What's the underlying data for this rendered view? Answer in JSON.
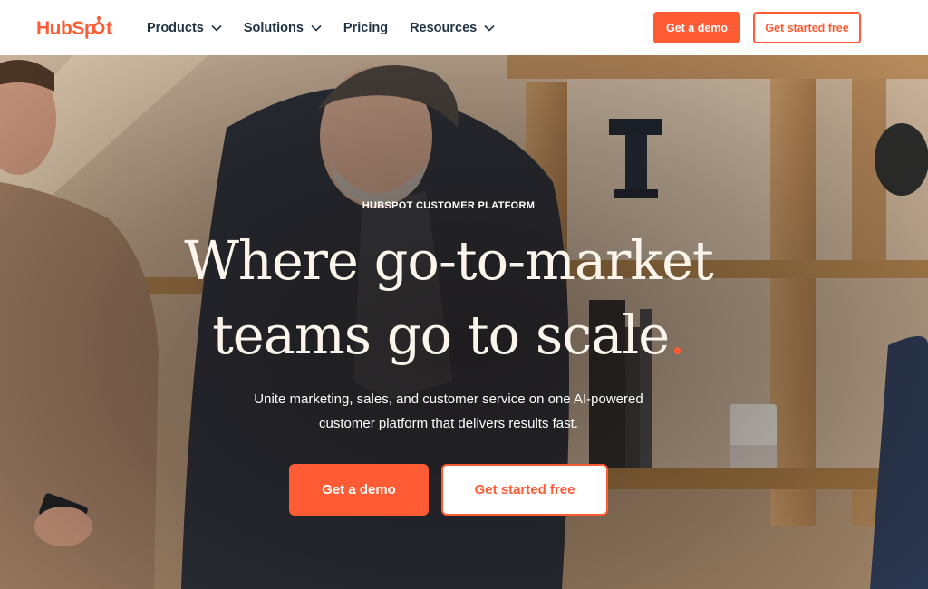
{
  "header": {
    "logo_text": "HubSpot",
    "nav": [
      {
        "label": "Products",
        "has_dropdown": true
      },
      {
        "label": "Solutions",
        "has_dropdown": true
      },
      {
        "label": "Pricing",
        "has_dropdown": false
      },
      {
        "label": "Resources",
        "has_dropdown": true
      }
    ],
    "demo_label": "Get a demo",
    "free_label": "Get started free"
  },
  "hero": {
    "eyebrow": "HUBSPOT CUSTOMER PLATFORM",
    "headline_line1": "Where go-to-market",
    "headline_line2": "teams go to scale",
    "headline_dot": ".",
    "subtitle_line1": "Unite marketing, sales, and customer service on one AI-powered",
    "subtitle_line2": "customer platform that delivers results fast.",
    "demo_label": "Get a demo",
    "free_label": "Get started free"
  },
  "colors": {
    "brand_orange": "#ff5c35",
    "nav_text": "#213343",
    "headline_text": "#fbf4ea"
  }
}
